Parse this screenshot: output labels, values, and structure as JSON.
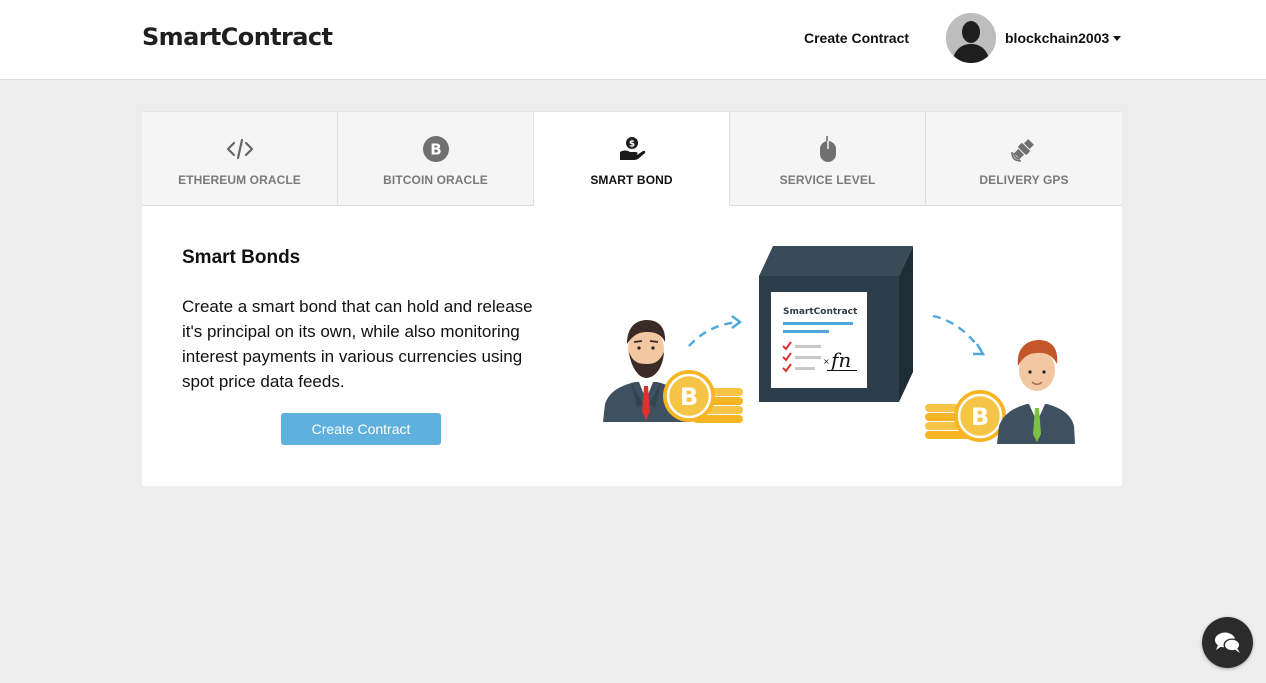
{
  "header": {
    "logo": "SmartContract",
    "nav_create": "Create Contract",
    "username": "blockchain2003"
  },
  "tabs": [
    {
      "label": "ETHEREUM ORACLE",
      "icon": "code-icon",
      "active": false
    },
    {
      "label": "BITCOIN ORACLE",
      "icon": "bitcoin-icon",
      "active": false
    },
    {
      "label": "SMART BOND",
      "icon": "hand-coin-icon",
      "active": true
    },
    {
      "label": "SERVICE LEVEL",
      "icon": "mouse-icon",
      "active": false
    },
    {
      "label": "DELIVERY GPS",
      "icon": "satellite-icon",
      "active": false
    }
  ],
  "content": {
    "title": "Smart Bonds",
    "description": "Create a smart bond that can hold and release it's principal on its own, while also monitoring interest payments in various currencies using spot price data feeds.",
    "button": "Create Contract",
    "illustration": {
      "brand": "SmartContract",
      "signature": "fn",
      "bitcoin_symbol": "B"
    }
  },
  "colors": {
    "accent": "#5eb0dd",
    "bitcoin": "#f7b524",
    "box": "#2d3e4a",
    "background": "#ededed"
  }
}
